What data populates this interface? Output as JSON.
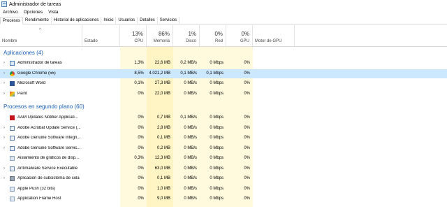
{
  "window": {
    "title": "Administrador de tareas"
  },
  "menu": [
    "Archivo",
    "Opciones",
    "Vista"
  ],
  "tabs": [
    "Procesos",
    "Rendimiento",
    "Historial de aplicaciones",
    "Inicio",
    "Usuarios",
    "Detalles",
    "Servicios"
  ],
  "columns": {
    "name": "Nombre",
    "status": "Estado",
    "cpu": {
      "pct": "13%",
      "label": "CPU"
    },
    "memory": {
      "pct": "86%",
      "label": "Memoria"
    },
    "disk": {
      "pct": "1%",
      "label": "Disco"
    },
    "network": {
      "pct": "0%",
      "label": "Red"
    },
    "gpu": {
      "pct": "0%",
      "label": "GPU"
    },
    "gpu_engine": "Motor de GPU"
  },
  "sections": {
    "apps": "Aplicaciones (4)",
    "background": "Procesos en segundo plano (60)"
  },
  "apps": [
    {
      "name": "Administrador de tareas",
      "icon": "task-manager-icon",
      "cpu": "1,3%",
      "mem": "22,6 MB",
      "disk": "0,2 MB/s",
      "net": "0 Mbps",
      "gpu": "0%",
      "expandable": true
    },
    {
      "name": "Google Chrome (55)",
      "icon": "chrome-icon",
      "cpu": "8,5%",
      "mem": "4.021,2 MB",
      "disk": "0,1 MB/s",
      "net": "0,1 Mbps",
      "gpu": "0%",
      "expandable": true,
      "selected": true
    },
    {
      "name": "Microsoft Word",
      "icon": "word-icon",
      "cpu": "0,1%",
      "mem": "27,3 MB",
      "disk": "0 MB/s",
      "net": "0 Mbps",
      "gpu": "0%",
      "expandable": true
    },
    {
      "name": "Paint",
      "icon": "paint-icon",
      "cpu": "0%",
      "mem": "22,0 MB",
      "disk": "0 MB/s",
      "net": "0 Mbps",
      "gpu": "0%",
      "expandable": true
    }
  ],
  "background": [
    {
      "name": "AAM Updates Notifier Applicati...",
      "icon": "adobe-icon",
      "cpu": "0%",
      "mem": "0,7 MB",
      "disk": "0,1 MB/s",
      "net": "0 Mbps",
      "gpu": "0%",
      "expandable": false
    },
    {
      "name": "Adobe Acrobat Update Service (...",
      "icon": "service-icon",
      "cpu": "0%",
      "mem": "2,8 MB",
      "disk": "0 MB/s",
      "net": "0 Mbps",
      "gpu": "0%",
      "expandable": true
    },
    {
      "name": "Adobe Genuine Software Integri...",
      "icon": "service-icon",
      "cpu": "0%",
      "mem": "0,1 MB",
      "disk": "0 MB/s",
      "net": "0 Mbps",
      "gpu": "0%",
      "expandable": true
    },
    {
      "name": "Adobe Genuine Software Servic...",
      "icon": "service-icon",
      "cpu": "0%",
      "mem": "0,2 MB",
      "disk": "0 MB/s",
      "net": "0 Mbps",
      "gpu": "0%",
      "expandable": true
    },
    {
      "name": "Aislamiento de gráficos de disp...",
      "icon": "app-icon",
      "cpu": "0,3%",
      "mem": "12,3 MB",
      "disk": "0 MB/s",
      "net": "0 Mbps",
      "gpu": "0%",
      "expandable": false
    },
    {
      "name": "Antimalware Service Executable",
      "icon": "service-icon",
      "cpu": "0%",
      "mem": "63,0 MB",
      "disk": "0 MB/s",
      "net": "0 Mbps",
      "gpu": "0%",
      "expandable": true
    },
    {
      "name": "Aplicación de subsistema de cola",
      "icon": "printer-icon",
      "cpu": "0%",
      "mem": "0,1 MB",
      "disk": "0 MB/s",
      "net": "0 Mbps",
      "gpu": "0%",
      "expandable": true
    },
    {
      "name": "Apple Push (32 bits)",
      "icon": "app-icon",
      "cpu": "0%",
      "mem": "1,0 MB",
      "disk": "0 MB/s",
      "net": "0 Mbps",
      "gpu": "0%",
      "expandable": false
    },
    {
      "name": "Application Frame Host",
      "icon": "app-icon",
      "cpu": "0%",
      "mem": "9,0 MB",
      "disk": "0 MB/s",
      "net": "0 Mbps",
      "gpu": "0%",
      "expandable": false
    }
  ],
  "colors": {
    "accent": "#1a5fb4",
    "heat_light": "#fff9dd",
    "heat": "#fff4c4",
    "selected": "#cce8ff"
  }
}
